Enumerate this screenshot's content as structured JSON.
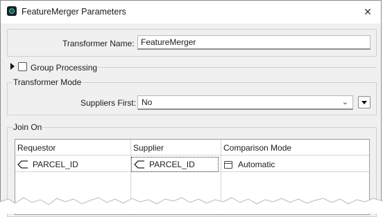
{
  "window": {
    "title": "FeatureMerger Parameters"
  },
  "transformer": {
    "name_label": "Transformer Name:",
    "name_value": "FeatureMerger"
  },
  "group_processing": {
    "label": "Group Processing",
    "checked": false
  },
  "mode": {
    "section_label": "Transformer Mode",
    "suppliers_first_label": "Suppliers First:",
    "suppliers_first_value": "No"
  },
  "join": {
    "section_label": "Join On",
    "columns": [
      "Requestor",
      "Supplier",
      "Comparison Mode"
    ],
    "rows": [
      {
        "requestor": "PARCEL_ID",
        "supplier": "PARCEL_ID",
        "comparison_mode": "Automatic"
      }
    ]
  },
  "icons": {
    "app": "featuremerger-app-icon",
    "close": "close-icon",
    "expand": "triangle-right-icon",
    "dropdown": "chevron-down-icon",
    "menu": "triangle-down-menu-icon",
    "attribute": "attribute-tag-icon",
    "mode": "window-icon"
  }
}
